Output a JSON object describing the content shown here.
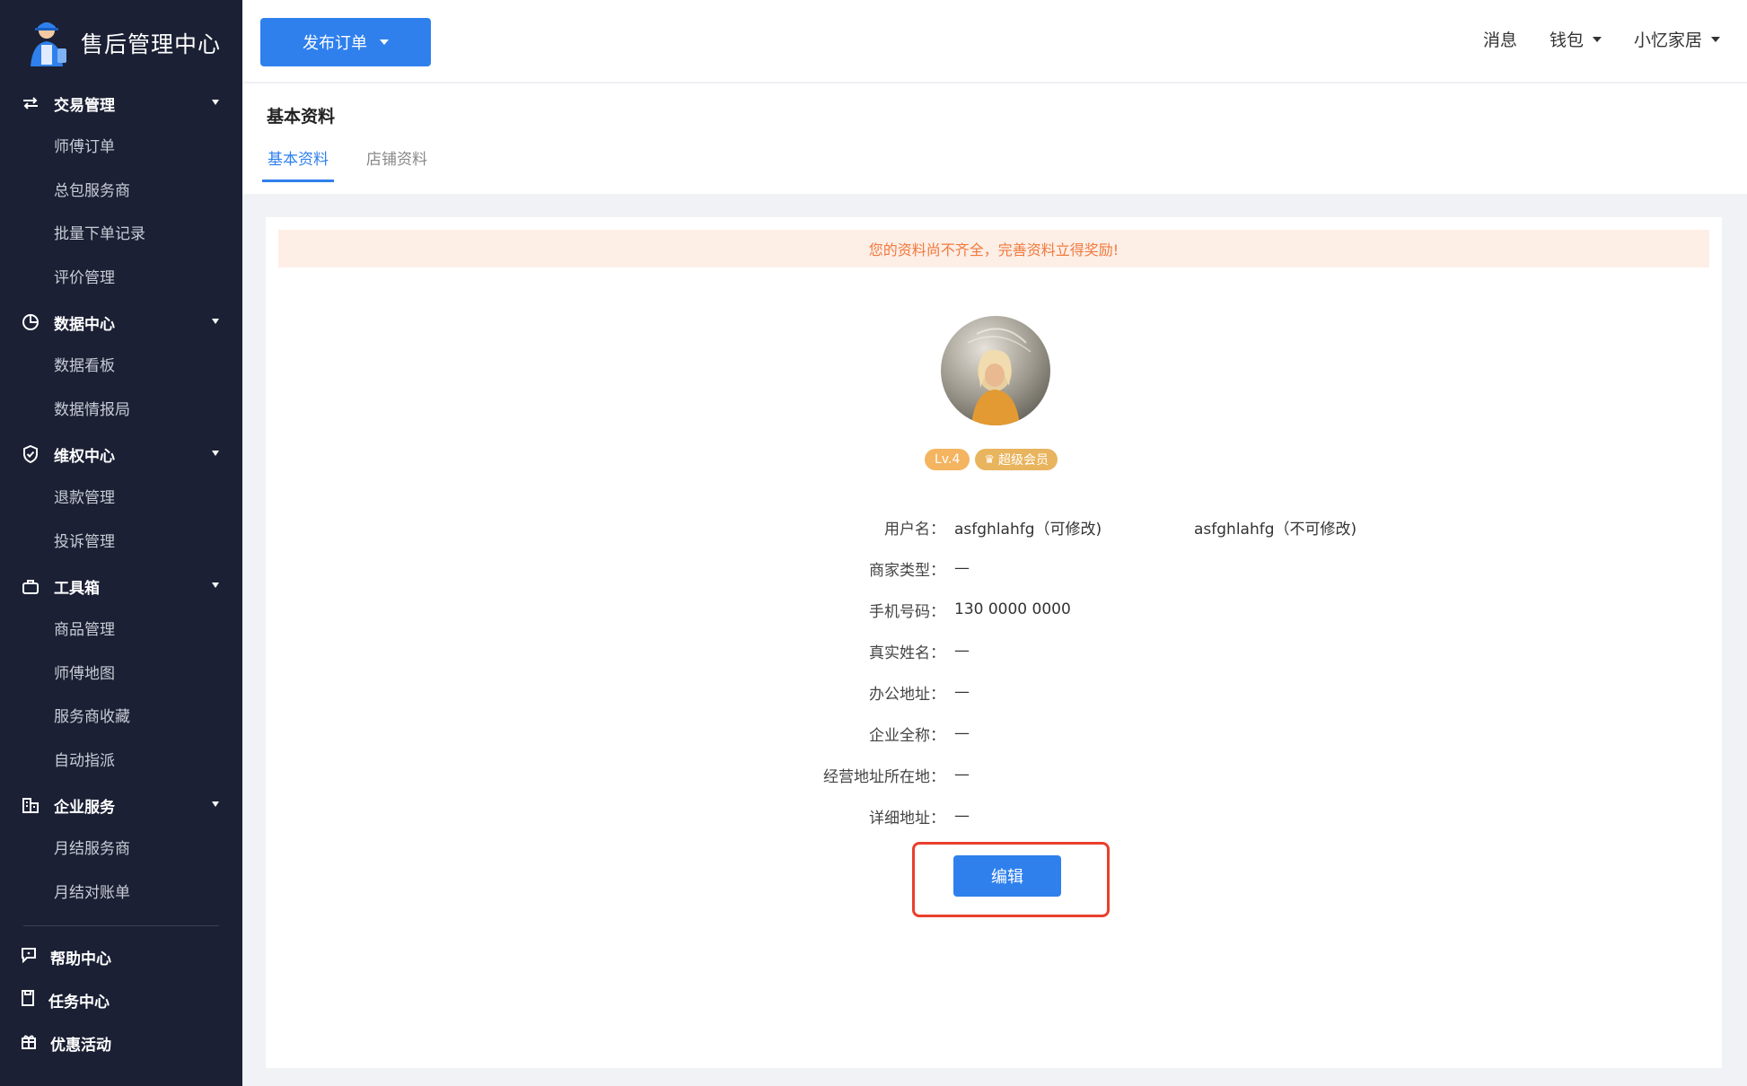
{
  "brand": {
    "title": "售后管理中心",
    "logo_icon": "technician-logo-icon"
  },
  "sidebar": {
    "groups": [
      {
        "label": "交易管理",
        "icon": "swap-icon",
        "items": [
          "师傅订单",
          "总包服务商",
          "批量下单记录",
          "评价管理"
        ]
      },
      {
        "label": "数据中心",
        "icon": "pie-chart-icon",
        "items": [
          "数据看板",
          "数据情报局"
        ]
      },
      {
        "label": "维权中心",
        "icon": "shield-check-icon",
        "items": [
          "退款管理",
          "投诉管理"
        ]
      },
      {
        "label": "工具箱",
        "icon": "toolbox-icon",
        "items": [
          "商品管理",
          "师傅地图",
          "服务商收藏",
          "自动指派"
        ]
      },
      {
        "label": "企业服务",
        "icon": "building-icon",
        "items": [
          "月结服务商",
          "月结对账单"
        ]
      }
    ],
    "bottom": [
      {
        "label": "帮助中心",
        "icon": "help-chat-icon"
      },
      {
        "label": "任务中心",
        "icon": "task-icon"
      },
      {
        "label": "优惠活动",
        "icon": "gift-icon"
      }
    ]
  },
  "header": {
    "publish_label": "发布订单",
    "messages_label": "消息",
    "wallet_label": "钱包",
    "account_label": "小忆家居"
  },
  "page": {
    "title": "基本资料",
    "tabs": [
      {
        "label": "基本资料",
        "active": true
      },
      {
        "label": "店铺资料",
        "active": false
      }
    ],
    "notice": "您的资料尚不齐全，完善资料立得奖励!",
    "level_badge": "Lv.4",
    "vip_badge": "超级会员",
    "fields": [
      {
        "label": "用户名：",
        "value": "asfghlahfg（可修改)",
        "extra": "asfghlahfg（不可修改)"
      },
      {
        "label": "商家类型：",
        "value": "—"
      },
      {
        "label": "手机号码：",
        "value": "130 0000 0000"
      },
      {
        "label": "真实姓名：",
        "value": "—"
      },
      {
        "label": "办公地址：",
        "value": "—"
      },
      {
        "label": "企业全称：",
        "value": "—"
      },
      {
        "label": "经营地址所在地：",
        "value": "—"
      },
      {
        "label": "详细地址：",
        "value": "—"
      }
    ],
    "edit_label": "编辑"
  },
  "colors": {
    "sidebar_bg": "#1b2034",
    "primary": "#2f80ed",
    "notice_bg": "#fdeee6",
    "notice_text": "#f07a3e",
    "highlight_frame": "#ea3f2c"
  }
}
